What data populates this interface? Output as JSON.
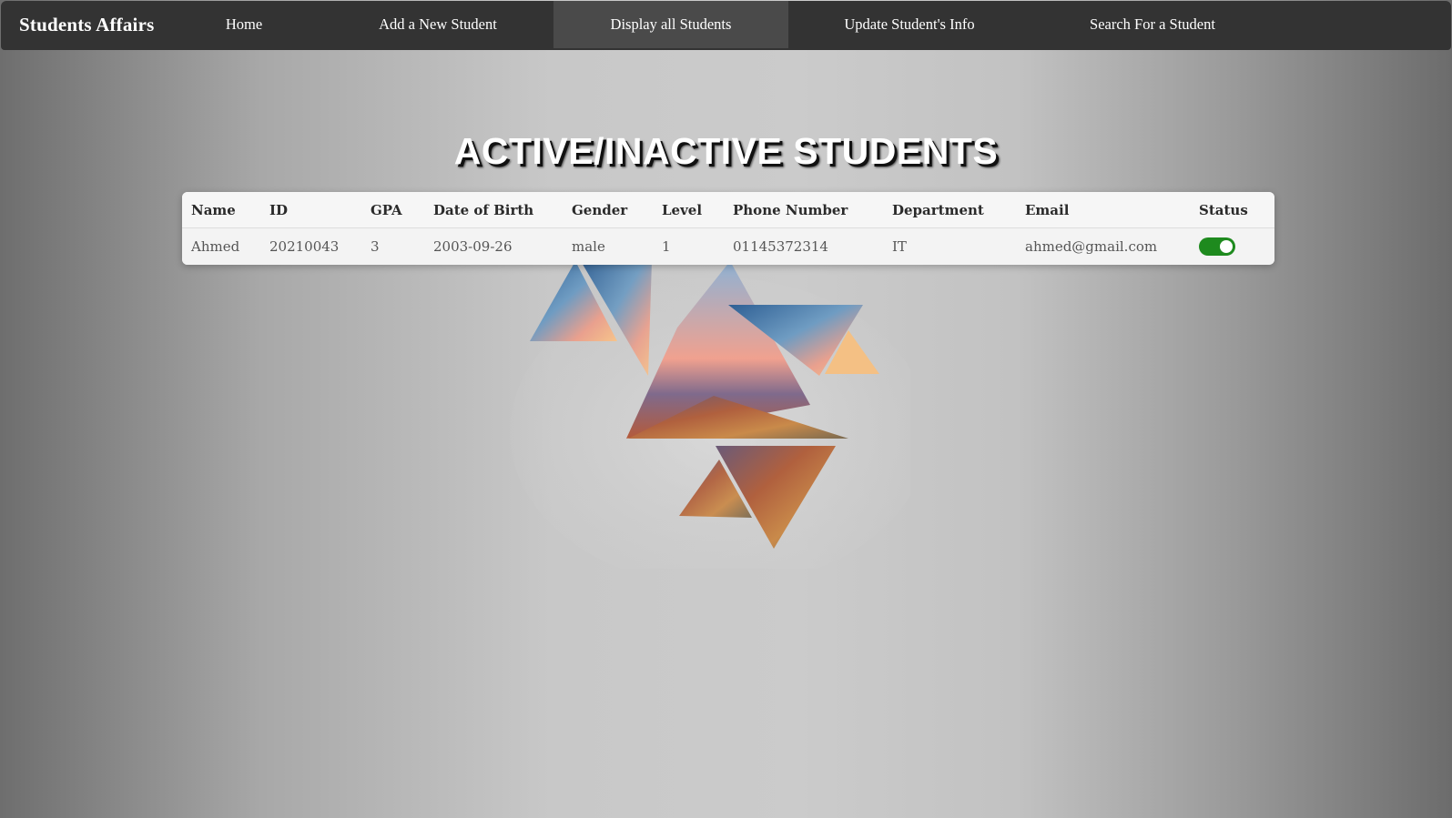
{
  "nav": {
    "brand": "Students Affairs",
    "items": [
      {
        "label": "Home"
      },
      {
        "label": "Add a New Student"
      },
      {
        "label": "Display all Students"
      },
      {
        "label": "Update Student's Info"
      },
      {
        "label": "Search For a Student"
      }
    ],
    "active_item": "Display all Students"
  },
  "page_title": "ACTIVE/INACTIVE STUDENTS",
  "table": {
    "headers": [
      "Name",
      "ID",
      "GPA",
      "Date of Birth",
      "Gender",
      "Level",
      "Phone Number",
      "Department",
      "Email",
      "Status"
    ],
    "rows": [
      {
        "name": "Ahmed",
        "id": "20210043",
        "gpa": "3",
        "dob": "2003-09-26",
        "gender": "male",
        "level": "1",
        "phone": "01145372314",
        "department": "IT",
        "email": "ahmed@gmail.com",
        "status_active": true
      }
    ]
  },
  "colors": {
    "navbar": "#333333",
    "active_nav": "#4a4a4a",
    "toggle_on": "#1e8a1e"
  },
  "icons": {
    "status_toggle": "toggle-switch-on"
  }
}
